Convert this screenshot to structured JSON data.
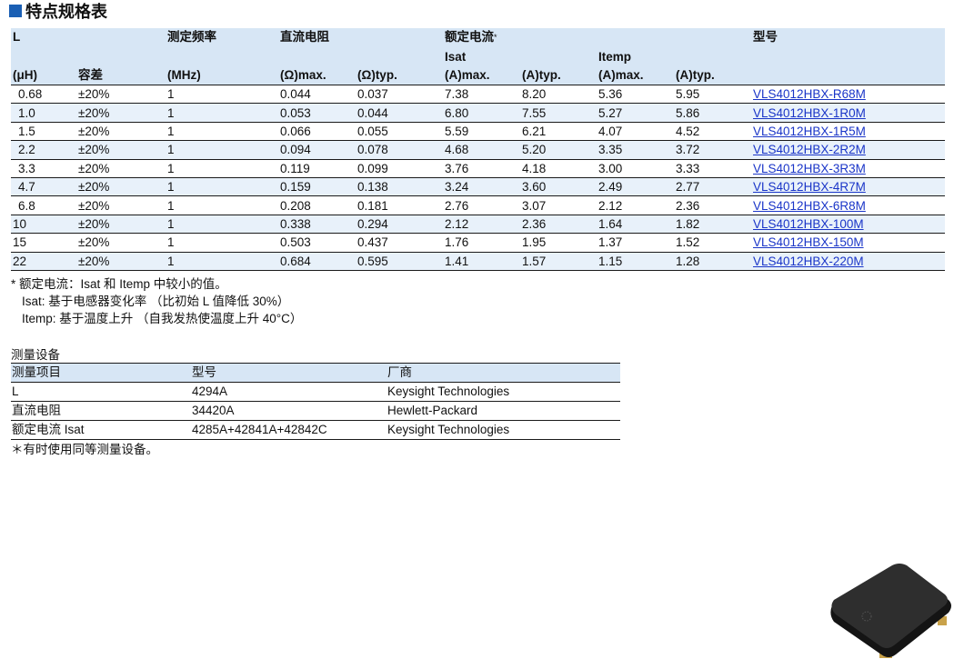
{
  "title": "特点规格表",
  "spec_table": {
    "header": {
      "l": "L",
      "l_unit": "(μH)",
      "tolerance": "容差",
      "freq": "测定频率",
      "freq_unit": "(MHz)",
      "dcr": "直流电阻",
      "dcr_max": "(Ω)max.",
      "dcr_typ": "(Ω)typ.",
      "rated_current": "额定电流",
      "rated_star": "*",
      "isat": "Isat",
      "isat_max": "(A)max.",
      "isat_typ": "(A)typ.",
      "itemp": "Itemp",
      "itemp_max": "(A)max.",
      "itemp_typ": "(A)typ.",
      "model": "型号"
    },
    "rows": [
      {
        "l": "0.68",
        "tol": "±20%",
        "freq": "1",
        "dcr_max": "0.044",
        "dcr_typ": "0.037",
        "isat_max": "7.38",
        "isat_typ": "8.20",
        "itemp_max": "5.36",
        "itemp_typ": "5.95",
        "model": "VLS4012HBX-R68M"
      },
      {
        "l": "1.0",
        "tol": "±20%",
        "freq": "1",
        "dcr_max": "0.053",
        "dcr_typ": "0.044",
        "isat_max": "6.80",
        "isat_typ": "7.55",
        "itemp_max": "5.27",
        "itemp_typ": "5.86",
        "model": "VLS4012HBX-1R0M"
      },
      {
        "l": "1.5",
        "tol": "±20%",
        "freq": "1",
        "dcr_max": "0.066",
        "dcr_typ": "0.055",
        "isat_max": "5.59",
        "isat_typ": "6.21",
        "itemp_max": "4.07",
        "itemp_typ": "4.52",
        "model": "VLS4012HBX-1R5M"
      },
      {
        "l": "2.2",
        "tol": "±20%",
        "freq": "1",
        "dcr_max": "0.094",
        "dcr_typ": "0.078",
        "isat_max": "4.68",
        "isat_typ": "5.20",
        "itemp_max": "3.35",
        "itemp_typ": "3.72",
        "model": "VLS4012HBX-2R2M"
      },
      {
        "l": "3.3",
        "tol": "±20%",
        "freq": "1",
        "dcr_max": "0.119",
        "dcr_typ": "0.099",
        "isat_max": "3.76",
        "isat_typ": "4.18",
        "itemp_max": "3.00",
        "itemp_typ": "3.33",
        "model": "VLS4012HBX-3R3M"
      },
      {
        "l": "4.7",
        "tol": "±20%",
        "freq": "1",
        "dcr_max": "0.159",
        "dcr_typ": "0.138",
        "isat_max": "3.24",
        "isat_typ": "3.60",
        "itemp_max": "2.49",
        "itemp_typ": "2.77",
        "model": "VLS4012HBX-4R7M"
      },
      {
        "l": "6.8",
        "tol": "±20%",
        "freq": "1",
        "dcr_max": "0.208",
        "dcr_typ": "0.181",
        "isat_max": "2.76",
        "isat_typ": "3.07",
        "itemp_max": "2.12",
        "itemp_typ": "2.36",
        "model": "VLS4012HBX-6R8M"
      },
      {
        "l": "10",
        "tol": "±20%",
        "freq": "1",
        "dcr_max": "0.338",
        "dcr_typ": "0.294",
        "isat_max": "2.12",
        "isat_typ": "2.36",
        "itemp_max": "1.64",
        "itemp_typ": "1.82",
        "model": "VLS4012HBX-100M"
      },
      {
        "l": "15",
        "tol": "±20%",
        "freq": "1",
        "dcr_max": "0.503",
        "dcr_typ": "0.437",
        "isat_max": "1.76",
        "isat_typ": "1.95",
        "itemp_max": "1.37",
        "itemp_typ": "1.52",
        "model": "VLS4012HBX-150M"
      },
      {
        "l": "22",
        "tol": "±20%",
        "freq": "1",
        "dcr_max": "0.684",
        "dcr_typ": "0.595",
        "isat_max": "1.41",
        "isat_typ": "1.57",
        "itemp_max": "1.15",
        "itemp_typ": "1.28",
        "model": "VLS4012HBX-220M"
      }
    ]
  },
  "notes": [
    "* 额定电流：Isat 和 Itemp 中较小的值。",
    "Isat: 基于电感器变化率 （比初始 L 值降低 30%）",
    "Itemp: 基于温度上升 （自我发热使温度上升 40°C）"
  ],
  "measurement": {
    "title": "测量设备",
    "headers": [
      "测量项目",
      "型号",
      "厂商"
    ],
    "rows": [
      [
        "L",
        "4294A",
        "Keysight Technologies"
      ],
      [
        "直流电阻",
        "34420A",
        "Hewlett-Packard"
      ],
      [
        "额定电流 Isat",
        "4285A+42841A+42842C",
        "Keysight Technologies"
      ]
    ],
    "footnote": "＊有时使用同等测量设备。"
  },
  "colors": {
    "header_bg": "#d7e6f5",
    "alt_row_bg": "#e8f1fa",
    "link": "#1a35c8",
    "title_square": "#1a5fb4"
  }
}
